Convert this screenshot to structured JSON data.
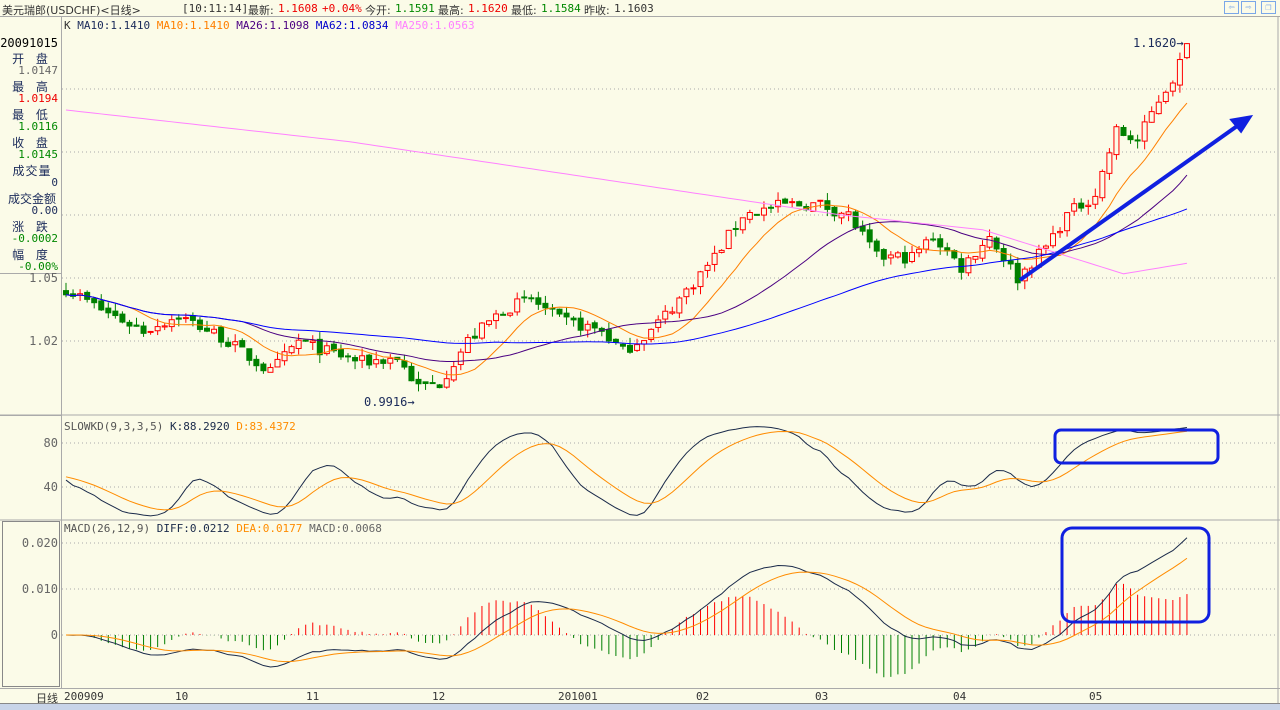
{
  "header": {
    "title": "美元瑞郎(USDCHF)<日线>",
    "time": "[10:11:14]",
    "latest_label": "最新:",
    "latest": "1.1608",
    "change": "+0.04%",
    "open_label": "今开:",
    "open": "1.1591",
    "high_label": "最高:",
    "high": "1.1620",
    "low_label": "最低:",
    "low": "1.1584",
    "prev_label": "昨收:",
    "prev": "1.1603"
  },
  "nav": {
    "prev": "⇦",
    "next": "⇨",
    "restore": "❐"
  },
  "ma_legend": {
    "k": "K",
    "ma10a": "MA10:1.1410",
    "ma10b": "MA10:1.1410",
    "ma26": "MA26:1.1098",
    "ma62": "MA62:1.0834",
    "ma250": "MA250:1.0563"
  },
  "info": {
    "date": "20091015",
    "open_label": "开 盘",
    "open": "1.0147",
    "high_label": "最 高",
    "high": "1.0194",
    "low_label": "最 低",
    "low": "1.0116",
    "close_label": "收 盘",
    "close": "1.0145",
    "vol_label": "成交量",
    "vol": "0",
    "amount_label": "成交金额",
    "amount": "0.00",
    "chg_label": "涨 跌",
    "chg": "-0.0002",
    "pct_label": "幅 度",
    "pct": "-0.00%"
  },
  "price_axis": {
    "t1": "1.05",
    "t2": "1.02"
  },
  "annotations": {
    "high": "1.1620→",
    "low": "0.9916→"
  },
  "kd": {
    "title": "SLOWKD(9,3,3,5)",
    "k": "K:88.2920",
    "d": "D:83.4372",
    "t80": "80",
    "t40": "40"
  },
  "macd": {
    "title": "MACD(26,12,9)",
    "diff": "DIFF:0.0212",
    "dea": "DEA:0.0177",
    "macd": "MACD:0.0068",
    "t1": "0.020",
    "t2": "0.010",
    "t3": "0"
  },
  "time_axis": {
    "label": "日线",
    "ticks": [
      "200909",
      "10",
      "11",
      "12",
      "201001",
      "02",
      "03",
      "04",
      "05"
    ]
  },
  "colors": {
    "up": "#ff0000",
    "down": "#008000",
    "ma10": "#ff7f00",
    "ma26": "#4b0082",
    "ma62": "#0000ff",
    "ma250": "#ff80ff",
    "k": "#1a2a4a",
    "d": "#ff8c00",
    "arrow": "#1020e0"
  },
  "chart_data": {
    "type": "candlestick",
    "price_path": [
      [
        0,
        1.045
      ],
      [
        5,
        1.035
      ],
      [
        11,
        1.025
      ],
      [
        16,
        1.032
      ],
      [
        22,
        1.022
      ],
      [
        29,
        1.005
      ],
      [
        33,
        1.02
      ],
      [
        37,
        1.015
      ],
      [
        42,
        1.01
      ],
      [
        47,
        1.012
      ],
      [
        50,
        0.998
      ],
      [
        53,
        1.0
      ],
      [
        57,
        1.02
      ],
      [
        62,
        1.035
      ],
      [
        66,
        1.04
      ],
      [
        70,
        1.03
      ],
      [
        76,
        1.025
      ],
      [
        79,
        1.015
      ],
      [
        83,
        1.025
      ],
      [
        87,
        1.04
      ],
      [
        92,
        1.06
      ],
      [
        96,
        1.08
      ],
      [
        102,
        1.085
      ],
      [
        107,
        1.085
      ],
      [
        111,
        1.08
      ],
      [
        115,
        1.06
      ],
      [
        120,
        1.06
      ],
      [
        123,
        1.07
      ],
      [
        127,
        1.055
      ],
      [
        131,
        1.07
      ],
      [
        135,
        1.05
      ],
      [
        139,
        1.065
      ],
      [
        142,
        1.08
      ],
      [
        146,
        1.09
      ],
      [
        149,
        1.12
      ],
      [
        152,
        1.115
      ],
      [
        155,
        1.135
      ],
      [
        157,
        1.145
      ],
      [
        159,
        1.16
      ]
    ],
    "ma250_path": [
      [
        0,
        1.13
      ],
      [
        40,
        1.115
      ],
      [
        80,
        1.095
      ],
      [
        110,
        1.08
      ],
      [
        130,
        1.073
      ],
      [
        150,
        1.052
      ],
      [
        159,
        1.057
      ]
    ],
    "ylim": [
      0.98,
      1.17
    ]
  }
}
